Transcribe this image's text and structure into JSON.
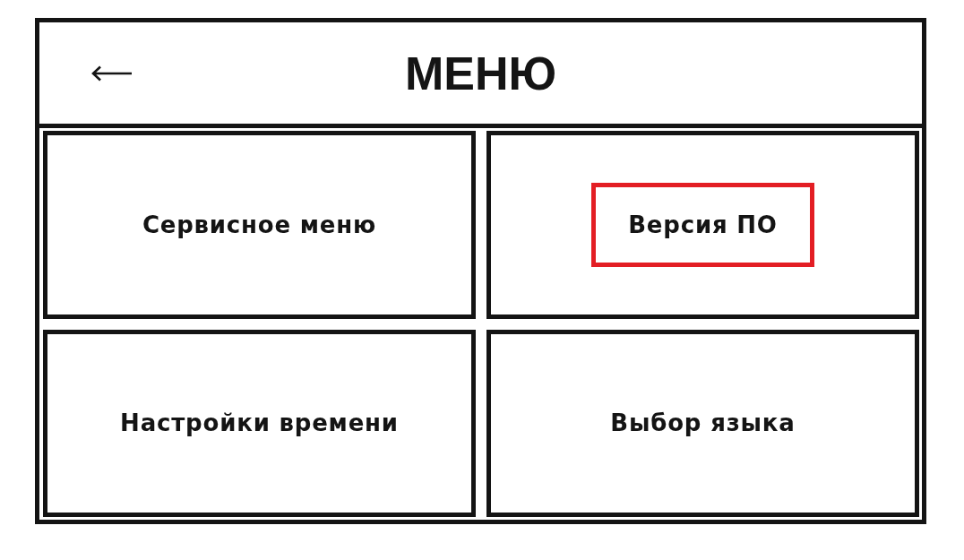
{
  "header": {
    "title": "МЕНЮ"
  },
  "items": [
    {
      "label": "Сервисное меню",
      "highlighted": false
    },
    {
      "label": "Версия ПО",
      "highlighted": true
    },
    {
      "label": "Настройки времени",
      "highlighted": false
    },
    {
      "label": "Выбор языка",
      "highlighted": false
    }
  ]
}
